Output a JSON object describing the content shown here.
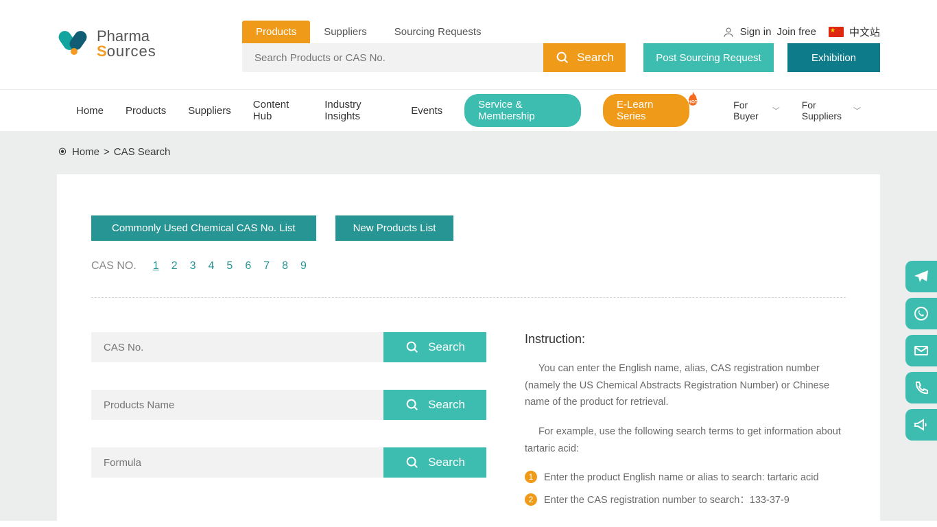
{
  "logo": {
    "line1": "Pharma",
    "line2a": "S",
    "line2b": "ources"
  },
  "search_tabs": {
    "products": "Products",
    "suppliers": "Suppliers",
    "sourcing": "Sourcing Requests"
  },
  "auth": {
    "sign_in": "Sign in",
    "join_free": "Join free",
    "lang": "中文站"
  },
  "search": {
    "placeholder": "Search Products or CAS No.",
    "button": "Search"
  },
  "buttons": {
    "post": "Post Sourcing Request",
    "exhibition": "Exhibition"
  },
  "nav": {
    "home": "Home",
    "products": "Products",
    "suppliers": "Suppliers",
    "content": "Content Hub",
    "insights": "Industry Insights",
    "events": "Events",
    "service": "Service & Membership",
    "elearn": "E-Learn Series",
    "buyer": "For Buyer",
    "suppliers2": "For Suppliers"
  },
  "breadcrumb": {
    "home": "Home",
    "sep": ">",
    "page": "CAS Search"
  },
  "tabs": {
    "list": "Commonly Used Chemical CAS No. List",
    "new": "New Products List"
  },
  "casno": {
    "label": "CAS NO.",
    "n1": "1",
    "n2": "2",
    "n3": "3",
    "n4": "4",
    "n5": "5",
    "n6": "6",
    "n7": "7",
    "n8": "8",
    "n9": "9"
  },
  "fields": {
    "cas_ph": "CAS No.",
    "name_ph": "Products Name",
    "formula_ph": "Formula",
    "go": "Search"
  },
  "instruction": {
    "title": "Instruction:",
    "p1": "You can enter the English name, alias, CAS registration number (namely the US Chemical Abstracts Registration Number) or Chinese name of the product for retrieval.",
    "p2": "For example, use the following search terms to get information about tartaric acid:",
    "li1": "Enter the product English name or alias to search: tartaric acid",
    "li2": "Enter the CAS registration number to search：133-37-9",
    "b1": "1",
    "b2": "2"
  }
}
